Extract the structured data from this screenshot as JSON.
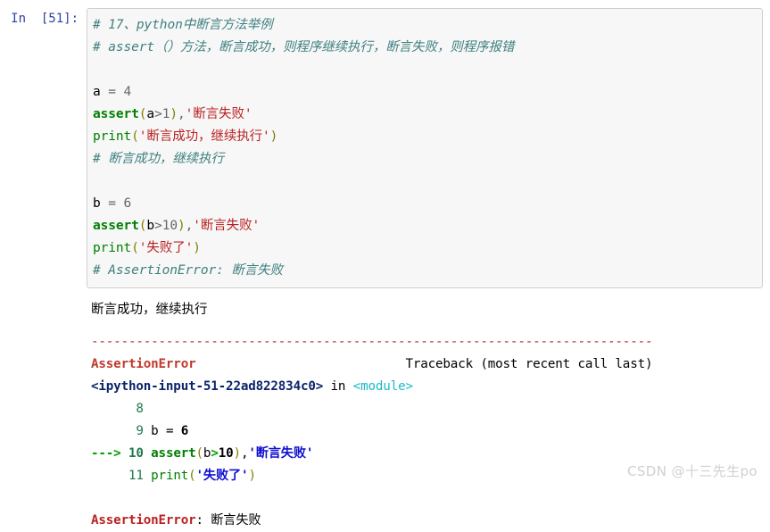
{
  "notebook": {
    "cell": {
      "prompt_label": "In  [51]:",
      "execution_count": 51,
      "code_lines": [
        {
          "tokens": [
            {
              "t": "# 17、python中断言方法举例",
              "c": "comment"
            }
          ]
        },
        {
          "tokens": [
            {
              "t": "# assert（）方法，断言成功，则程序继续执行，断言失败，则程序报错",
              "c": "comment"
            }
          ]
        },
        {
          "tokens": []
        },
        {
          "tokens": [
            {
              "t": "a ",
              "c": "name"
            },
            {
              "t": "=",
              "c": "operator"
            },
            {
              "t": " ",
              "c": "name"
            },
            {
              "t": "4",
              "c": "number"
            }
          ]
        },
        {
          "tokens": [
            {
              "t": "assert",
              "c": "keyword"
            },
            {
              "t": "(",
              "c": "paren"
            },
            {
              "t": "a",
              "c": "name"
            },
            {
              "t": ">",
              "c": "operator"
            },
            {
              "t": "1",
              "c": "number"
            },
            {
              "t": ")",
              "c": "paren"
            },
            {
              "t": ",",
              "c": "punct"
            },
            {
              "t": "'断言失败'",
              "c": "string"
            }
          ]
        },
        {
          "tokens": [
            {
              "t": "print",
              "c": "builtin"
            },
            {
              "t": "(",
              "c": "paren"
            },
            {
              "t": "'断言成功，继续执行'",
              "c": "string"
            },
            {
              "t": ")",
              "c": "paren"
            }
          ]
        },
        {
          "tokens": [
            {
              "t": "# 断言成功，继续执行",
              "c": "comment"
            }
          ]
        },
        {
          "tokens": []
        },
        {
          "tokens": [
            {
              "t": "b ",
              "c": "name"
            },
            {
              "t": "=",
              "c": "operator"
            },
            {
              "t": " ",
              "c": "name"
            },
            {
              "t": "6",
              "c": "number"
            }
          ]
        },
        {
          "tokens": [
            {
              "t": "assert",
              "c": "keyword"
            },
            {
              "t": "(",
              "c": "paren"
            },
            {
              "t": "b",
              "c": "name"
            },
            {
              "t": ">",
              "c": "operator"
            },
            {
              "t": "10",
              "c": "number"
            },
            {
              "t": ")",
              "c": "paren"
            },
            {
              "t": ",",
              "c": "punct"
            },
            {
              "t": "'断言失败'",
              "c": "string"
            }
          ]
        },
        {
          "tokens": [
            {
              "t": "print",
              "c": "builtin"
            },
            {
              "t": "(",
              "c": "paren"
            },
            {
              "t": "'失败了'",
              "c": "string"
            },
            {
              "t": ")",
              "c": "paren"
            }
          ]
        },
        {
          "tokens": [
            {
              "t": "# AssertionError: 断言失败",
              "c": "comment"
            }
          ]
        }
      ],
      "stdout": "断言成功，继续执行",
      "traceback_lines": [
        {
          "tokens": [
            {
              "t": "---------------------------------------------------------------------------",
              "c": "sep"
            }
          ]
        },
        {
          "tokens": [
            {
              "t": "AssertionError",
              "c": "errtype"
            },
            {
              "t": "                            Traceback (most recent call last)",
              "c": "plain"
            }
          ]
        },
        {
          "tokens": [
            {
              "t": "<ipython-input-51-22ad822834c0>",
              "c": "file"
            },
            {
              "t": " in ",
              "c": "plain"
            },
            {
              "t": "<module>",
              "c": "module"
            }
          ]
        },
        {
          "tokens": [
            {
              "t": "      8 ",
              "c": "lineno"
            }
          ]
        },
        {
          "tokens": [
            {
              "t": "      9 ",
              "c": "lineno"
            },
            {
              "t": "b ",
              "c": "num"
            },
            {
              "t": "= ",
              "c": "num"
            },
            {
              "t": "6",
              "c": "numb"
            }
          ]
        },
        {
          "tokens": [
            {
              "t": "---> ",
              "c": "arrow"
            },
            {
              "t": "10 ",
              "c": "arrowno"
            },
            {
              "t": "assert",
              "c": "kw"
            },
            {
              "t": "(",
              "c": "paren"
            },
            {
              "t": "b",
              "c": "num"
            },
            {
              "t": ">",
              "c": "arrow"
            },
            {
              "t": "10",
              "c": "numb"
            },
            {
              "t": ")",
              "c": "paren"
            },
            {
              "t": ",",
              "c": "num"
            },
            {
              "t": "'断言失败'",
              "c": "str"
            }
          ]
        },
        {
          "tokens": [
            {
              "t": "     11 ",
              "c": "lineno"
            },
            {
              "t": "print",
              "c": "builtin"
            },
            {
              "t": "(",
              "c": "paren"
            },
            {
              "t": "'失败了'",
              "c": "str"
            },
            {
              "t": ")",
              "c": "paren"
            }
          ]
        },
        {
          "tokens": []
        },
        {
          "tokens": [
            {
              "t": "AssertionError",
              "c": "errname"
            },
            {
              "t": ": 断言失败",
              "c": "plain"
            }
          ]
        }
      ]
    }
  },
  "watermark": {
    "text": "CSDN @十三先生po"
  },
  "colors": {
    "cell_background": "#f7f7f7",
    "cell_border": "#cfcfcf",
    "prompt": "#303F9F",
    "comment": "#408080",
    "keyword": "#008000",
    "string": "#BA2121",
    "error": "#C0392B",
    "separator": "#A52A2A",
    "file_link": "#0A246A",
    "module": "#19B9C9",
    "lineno": "#1F7A4D",
    "watermark": "#d0d0d0"
  }
}
